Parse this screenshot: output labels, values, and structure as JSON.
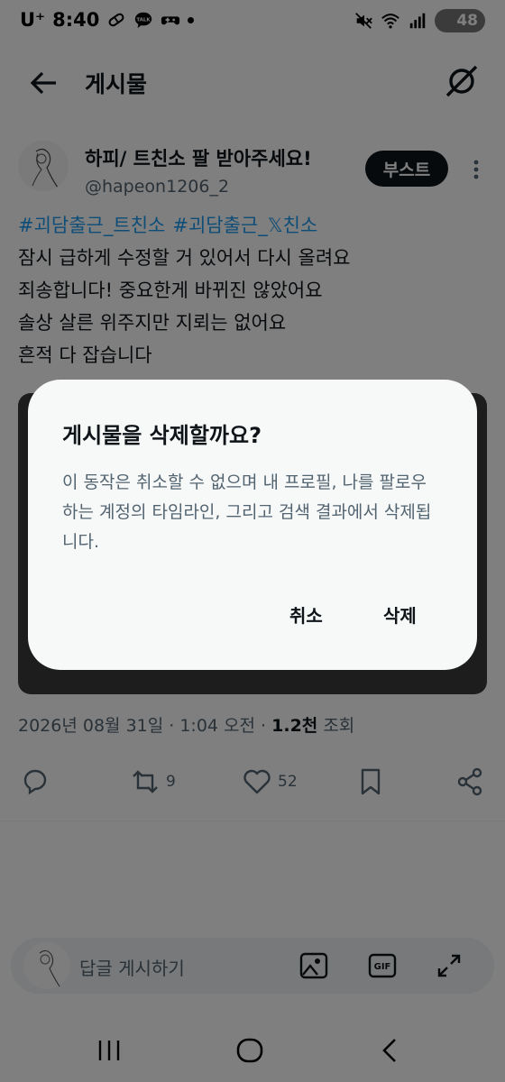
{
  "status_bar": {
    "carrier": "U⁺",
    "time": "8:40",
    "battery": "48"
  },
  "header": {
    "title": "게시물",
    "back_icon": "arrow-left-icon",
    "grok_icon": "grok-icon"
  },
  "post": {
    "author_name": "하피/ 트친소 팔 받아주세요!",
    "author_handle": "@hapeon1206_2",
    "boost_label": "부스트",
    "hashtags": [
      "#괴담출근_트친소",
      "#괴담출근_𝕏친소"
    ],
    "lines": [
      "잠시 급하게 수정할 거 있어서 다시 올려요",
      "죄송합니다! 중요한게 바뀌진 않았어요",
      "솔상 살른 위주지만 지뢰는 없어요",
      "흔적 다 잡습니다"
    ],
    "timestamp": "2026년 08월 31일 · 1:04 오전 · ",
    "views_count": "1.2천",
    "views_label": " 조회"
  },
  "actions": {
    "retweets": "9",
    "likes": "52"
  },
  "reply": {
    "placeholder": "답글 게시하기",
    "gif_label": "GIF"
  },
  "dialog": {
    "title": "게시물을 삭제할까요?",
    "message": "이 동작은 취소할 수 없으며 내 프로필, 나를 팔로우하는 계정의 타임라인, 그리고 검색 결과에서 삭제됩니다.",
    "cancel_label": "취소",
    "delete_label": "삭제"
  }
}
